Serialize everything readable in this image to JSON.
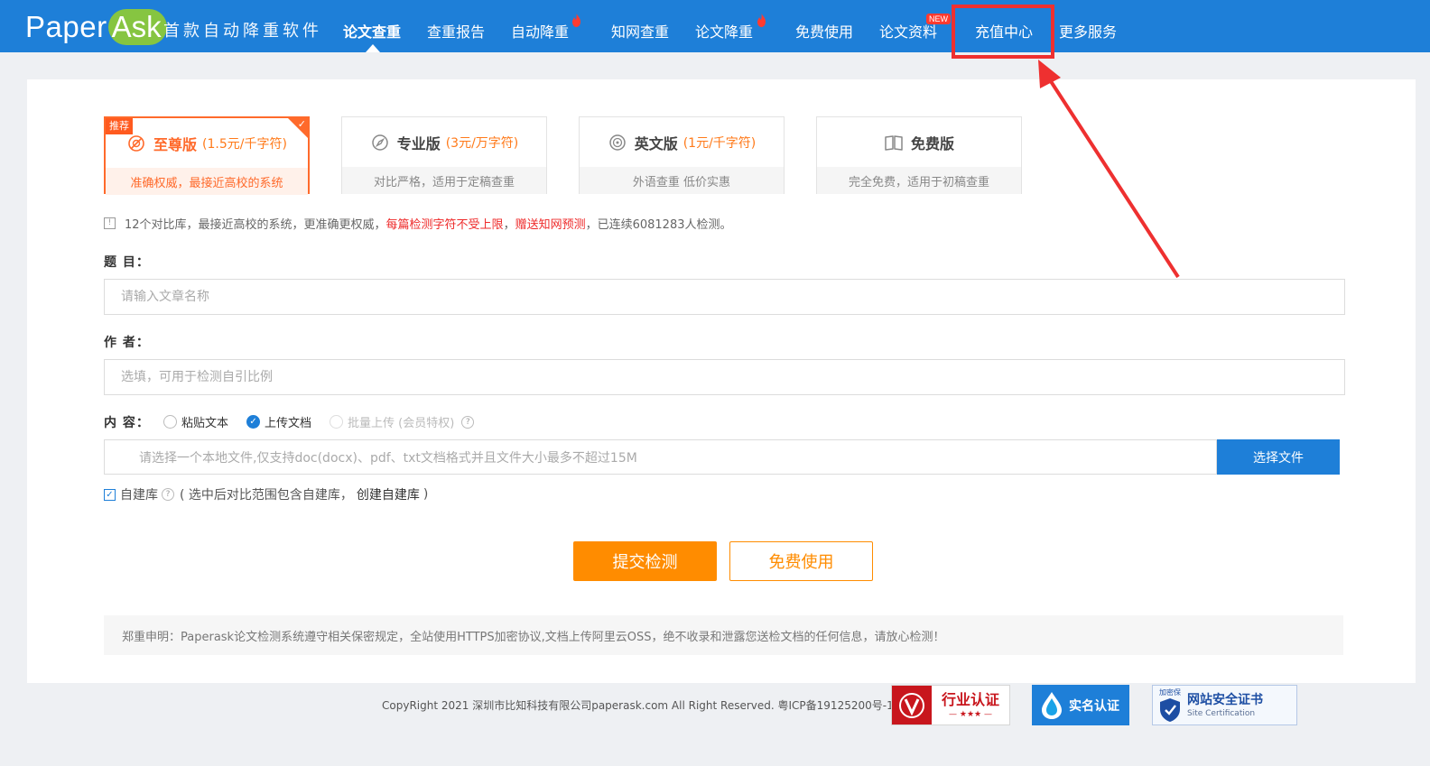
{
  "nav": {
    "logo_paper": "Paper",
    "logo_ask": "Ask",
    "slogan": "首款自动降重软件",
    "items": [
      {
        "label": "论文查重"
      },
      {
        "label": "查重报告"
      },
      {
        "label": "自动降重"
      },
      {
        "label": "知网查重"
      },
      {
        "label": "论文降重"
      },
      {
        "label": "免费使用"
      },
      {
        "label": "论文资料"
      },
      {
        "label": "充值中心"
      },
      {
        "label": "更多服务"
      }
    ],
    "new_badge": "NEW",
    "active_item": "论文查重",
    "highlighted_item": "充值中心",
    "highlight_color": "#ee3030",
    "brand_color": "#1e7fd8"
  },
  "versions": [
    {
      "badge": "推荐",
      "name": "至尊版",
      "price": "(1.5元/千字符)",
      "desc": "准确权威，最接近高校的系统",
      "icon": "target-slash-icon",
      "selected": true
    },
    {
      "name": "专业版",
      "price": "(3元/万字符)",
      "desc": "对比严格，适用于定稿查重",
      "icon": "compass-icon",
      "selected": false
    },
    {
      "name": "英文版",
      "price": "(1元/千字符)",
      "desc": "外语查重 低价实惠",
      "icon": "target-icon",
      "selected": false
    },
    {
      "name": "免费版",
      "price": "",
      "desc": "完全免费，适用于初稿查重",
      "icon": "book-icon",
      "selected": false
    }
  ],
  "notice": {
    "icon_glyph": "!",
    "part1": "12个对比库，最接近高校的系统，更准确更权威，",
    "red1": "每篇检测字符不受上限",
    "sep": "，",
    "red2": "赠送知网预测",
    "part2": "，已连续6081283人检测。"
  },
  "form": {
    "title_label": "题 目：",
    "title_placeholder": "请输入文章名称",
    "author_label": "作 者：",
    "author_placeholder": "选填，可用于检测自引比例",
    "content_label": "内 容：",
    "content_options": [
      {
        "label": "粘贴文本",
        "checked": false,
        "disabled": false
      },
      {
        "label": "上传文档",
        "checked": true,
        "disabled": false
      },
      {
        "label": "批量上传 (会员特权)",
        "checked": false,
        "disabled": true
      }
    ],
    "file_placeholder": "请选择一个本地文件,仅支持doc(docx)、pdf、txt文档格式并且文件大小最多不超过15M",
    "file_button": "选择文件",
    "selfdb_label": "自建库",
    "selfdb_checked": true,
    "selfdb_hint_open": "( 选中后对比范围包含自建库，",
    "selfdb_create": "创建自建库",
    "selfdb_hint_close": ")"
  },
  "actions": {
    "submit": "提交检测",
    "free": "免费使用",
    "accent_color": "#ff8c00"
  },
  "statement": "郑重申明：Paperask论文检测系统遵守相关保密规定，全站使用HTTPS加密协议,文档上传阿里云OSS，绝不收录和泄露您送检文档的任何信息，请放心检测！",
  "footer": {
    "copyright": "CopyRight 2021 深圳市比知科技有限公司paperask.com All Right Reserved. 粤ICP备19125200号-1",
    "badge_industry": "行业认证",
    "badge_industry_stars": "— ★★★ —",
    "badge_realname": "实名认证",
    "badge_security_tag": "加密保",
    "badge_security_title": "网站安全证书",
    "badge_security_sub": "Site Certification"
  }
}
